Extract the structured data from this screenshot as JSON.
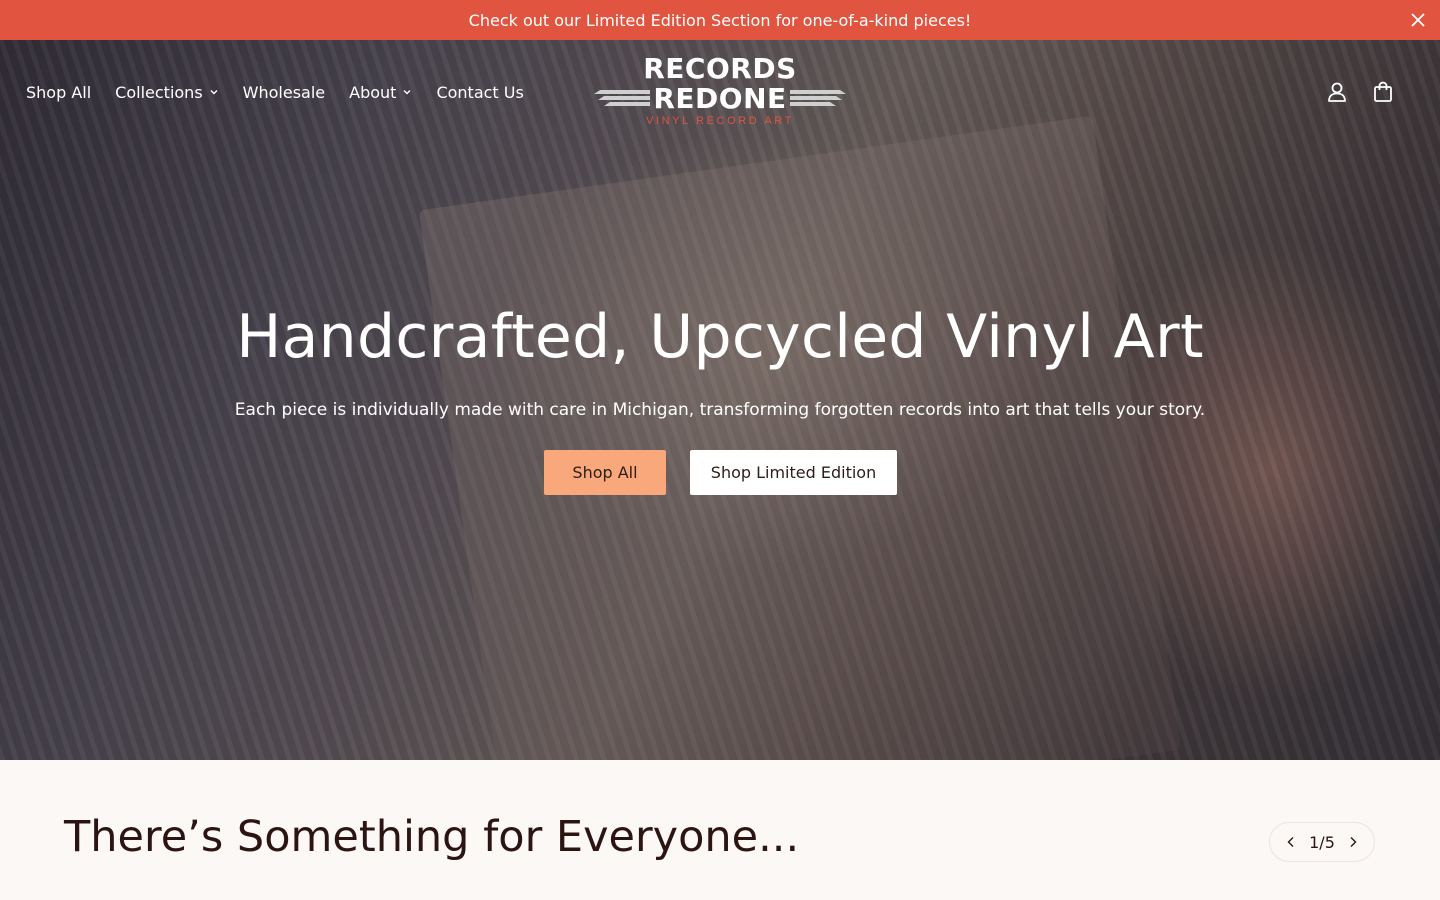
{
  "announcement": {
    "text": "Check out our Limited Edition Section for one-of-a-kind pieces!"
  },
  "nav": {
    "items": [
      {
        "label": "Shop All"
      },
      {
        "label": "Collections"
      },
      {
        "label": "Wholesale"
      },
      {
        "label": "About"
      },
      {
        "label": "Contact Us"
      }
    ]
  },
  "logo": {
    "line1": "RECORDS",
    "line2": "REDONE",
    "tagline": "VINYL RECORD ART"
  },
  "hero": {
    "title": "Handcrafted, Upcycled Vinyl Art",
    "subtitle": "Each piece is individually made with care in Michigan, transforming forgotten records into art that tells your story.",
    "primary_cta": "Shop All",
    "secondary_cta": "Shop Limited Edition"
  },
  "section": {
    "title": "There’s Something for Everyone...",
    "pager": "1/5"
  },
  "icons": {
    "close": "close-icon",
    "account": "account-icon",
    "cart": "cart-icon",
    "prev": "chevron-left-icon",
    "next": "chevron-right-icon",
    "dropdown": "chevron-down-icon"
  },
  "colors": {
    "announcement_bg": "#e05440",
    "primary_button": "#f8a87a",
    "page_bg": "#fcf8f5",
    "logo_accent": "#e05440"
  }
}
